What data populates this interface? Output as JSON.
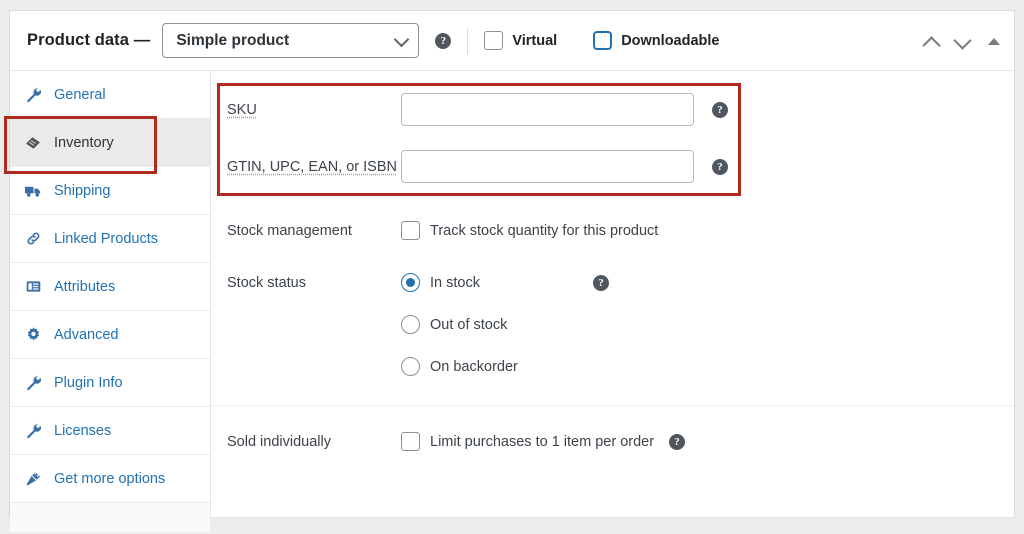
{
  "header": {
    "title": "Product data —",
    "product_type": "Simple product",
    "product_type_icon": "chevron-down-icon",
    "help_icon": "help-icon",
    "checkboxes": [
      {
        "label": "Virtual",
        "checked": false,
        "focused": false
      },
      {
        "label": "Downloadable",
        "checked": false,
        "focused": true
      }
    ],
    "controls": [
      {
        "name": "move-up-icon",
        "glyph": "up"
      },
      {
        "name": "move-down-icon",
        "glyph": "down"
      },
      {
        "name": "toggle-panel-icon",
        "glyph": "triangle"
      }
    ]
  },
  "tabs": [
    {
      "label": "General",
      "icon": "wrench-icon",
      "active": false
    },
    {
      "label": "Inventory",
      "icon": "inventory-box-icon",
      "active": true
    },
    {
      "label": "Shipping",
      "icon": "truck-icon",
      "active": false
    },
    {
      "label": "Linked Products",
      "icon": "link-icon",
      "active": false
    },
    {
      "label": "Attributes",
      "icon": "list-icon",
      "active": false
    },
    {
      "label": "Advanced",
      "icon": "gear-icon",
      "active": false
    },
    {
      "label": "Plugin Info",
      "icon": "wrench-icon",
      "active": false
    },
    {
      "label": "Licenses",
      "icon": "wrench-icon",
      "active": false
    },
    {
      "label": "Get more options",
      "icon": "plug-icon",
      "active": false
    }
  ],
  "inventory": {
    "sku": {
      "label": "SKU",
      "value": "",
      "placeholder": "",
      "help_icon": "help-icon"
    },
    "gtin": {
      "label": "GTIN, UPC, EAN, or ISBN",
      "value": "",
      "placeholder": "",
      "help_icon": "help-icon"
    },
    "stock_management": {
      "label": "Stock management",
      "checkbox_label": "Track stock quantity for this product",
      "checked": false
    },
    "stock_status": {
      "label": "Stock status",
      "help_icon": "help-icon",
      "selected": "In stock",
      "options": [
        {
          "label": "In stock",
          "checked": true
        },
        {
          "label": "Out of stock",
          "checked": false
        },
        {
          "label": "On backorder",
          "checked": false
        }
      ]
    },
    "sold_individually": {
      "label": "Sold individually",
      "checkbox_label": "Limit purchases to 1 item per order",
      "checked": false,
      "help_icon": "help-icon"
    }
  },
  "annotations": [
    {
      "name": "annotation-inventory-tab",
      "color": "#b02b1d"
    },
    {
      "name": "annotation-sku-gtin-fields",
      "color": "#b02b1d"
    }
  ]
}
